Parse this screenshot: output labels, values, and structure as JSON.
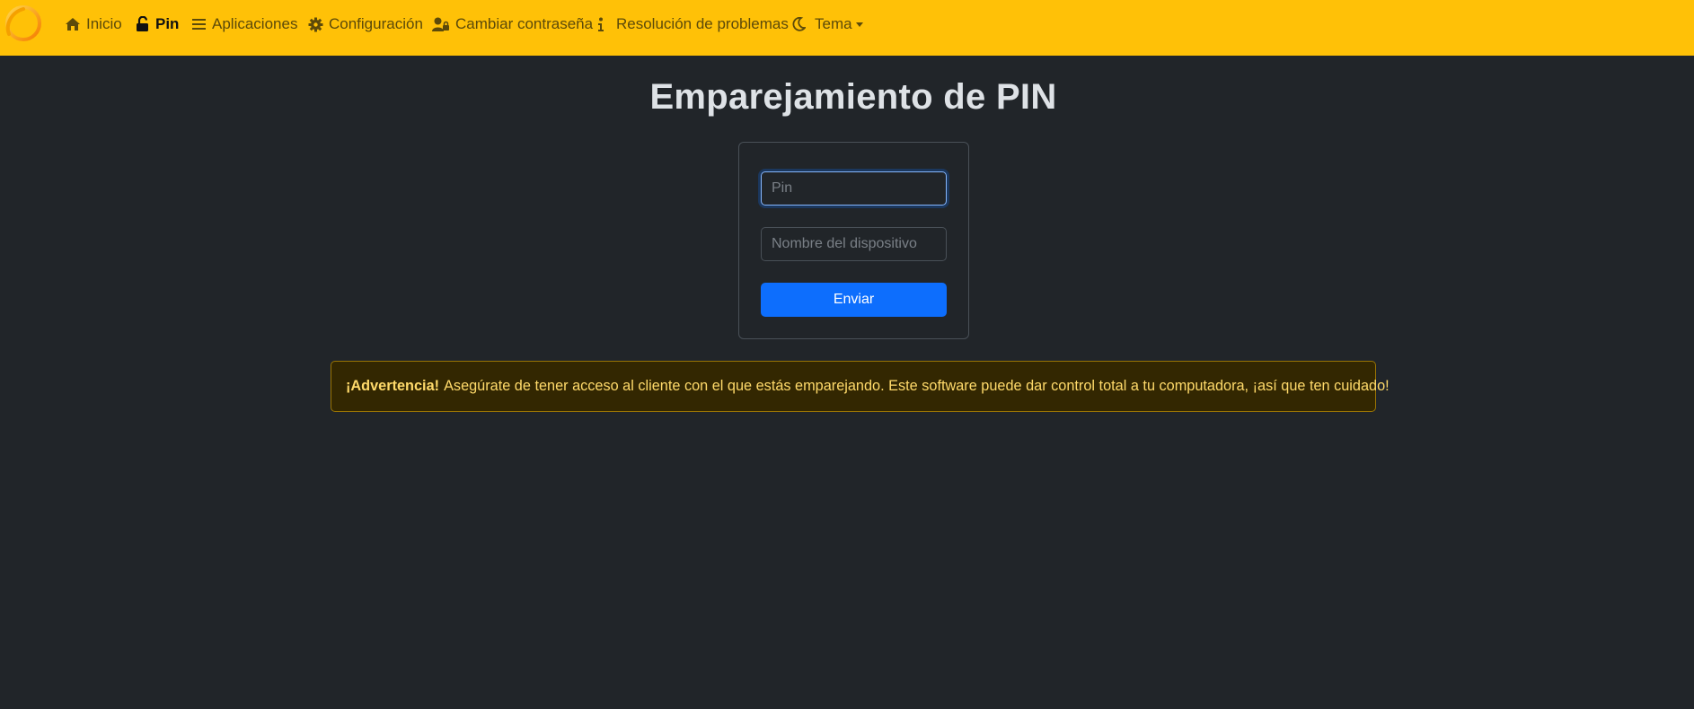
{
  "navbar": {
    "background": "#ffc107",
    "logo_icon": "sunshine-logo",
    "items": [
      {
        "label": "Inicio",
        "icon": "home-icon",
        "active": false
      },
      {
        "label": "Pin",
        "icon": "unlock-icon",
        "active": true
      },
      {
        "label": "Aplicaciones",
        "icon": "list-icon",
        "active": false
      },
      {
        "label": "Configuración",
        "icon": "gear-icon",
        "active": false
      },
      {
        "label": "Cambiar contraseña",
        "icon": "user-lock-icon",
        "active": false
      },
      {
        "label": "Resolución de problemas",
        "icon": "info-icon",
        "active": false
      },
      {
        "label": "Tema",
        "icon": "moon-icon",
        "active": false,
        "dropdown": true
      }
    ]
  },
  "main": {
    "title": "Emparejamiento de PIN",
    "form": {
      "pin_placeholder": "Pin",
      "pin_value": "",
      "device_placeholder": "Nombre del dispositivo",
      "device_value": "",
      "submit_label": "Enviar",
      "submit_color": "#0d6efd"
    },
    "alert": {
      "strong": "¡Advertencia!",
      "text": "Asegúrate de tener acceso al cliente con el que estás emparejando. Este software puede dar control total a tu computadora, ¡así que ten cuidado!",
      "color": "#ffda6a"
    }
  }
}
